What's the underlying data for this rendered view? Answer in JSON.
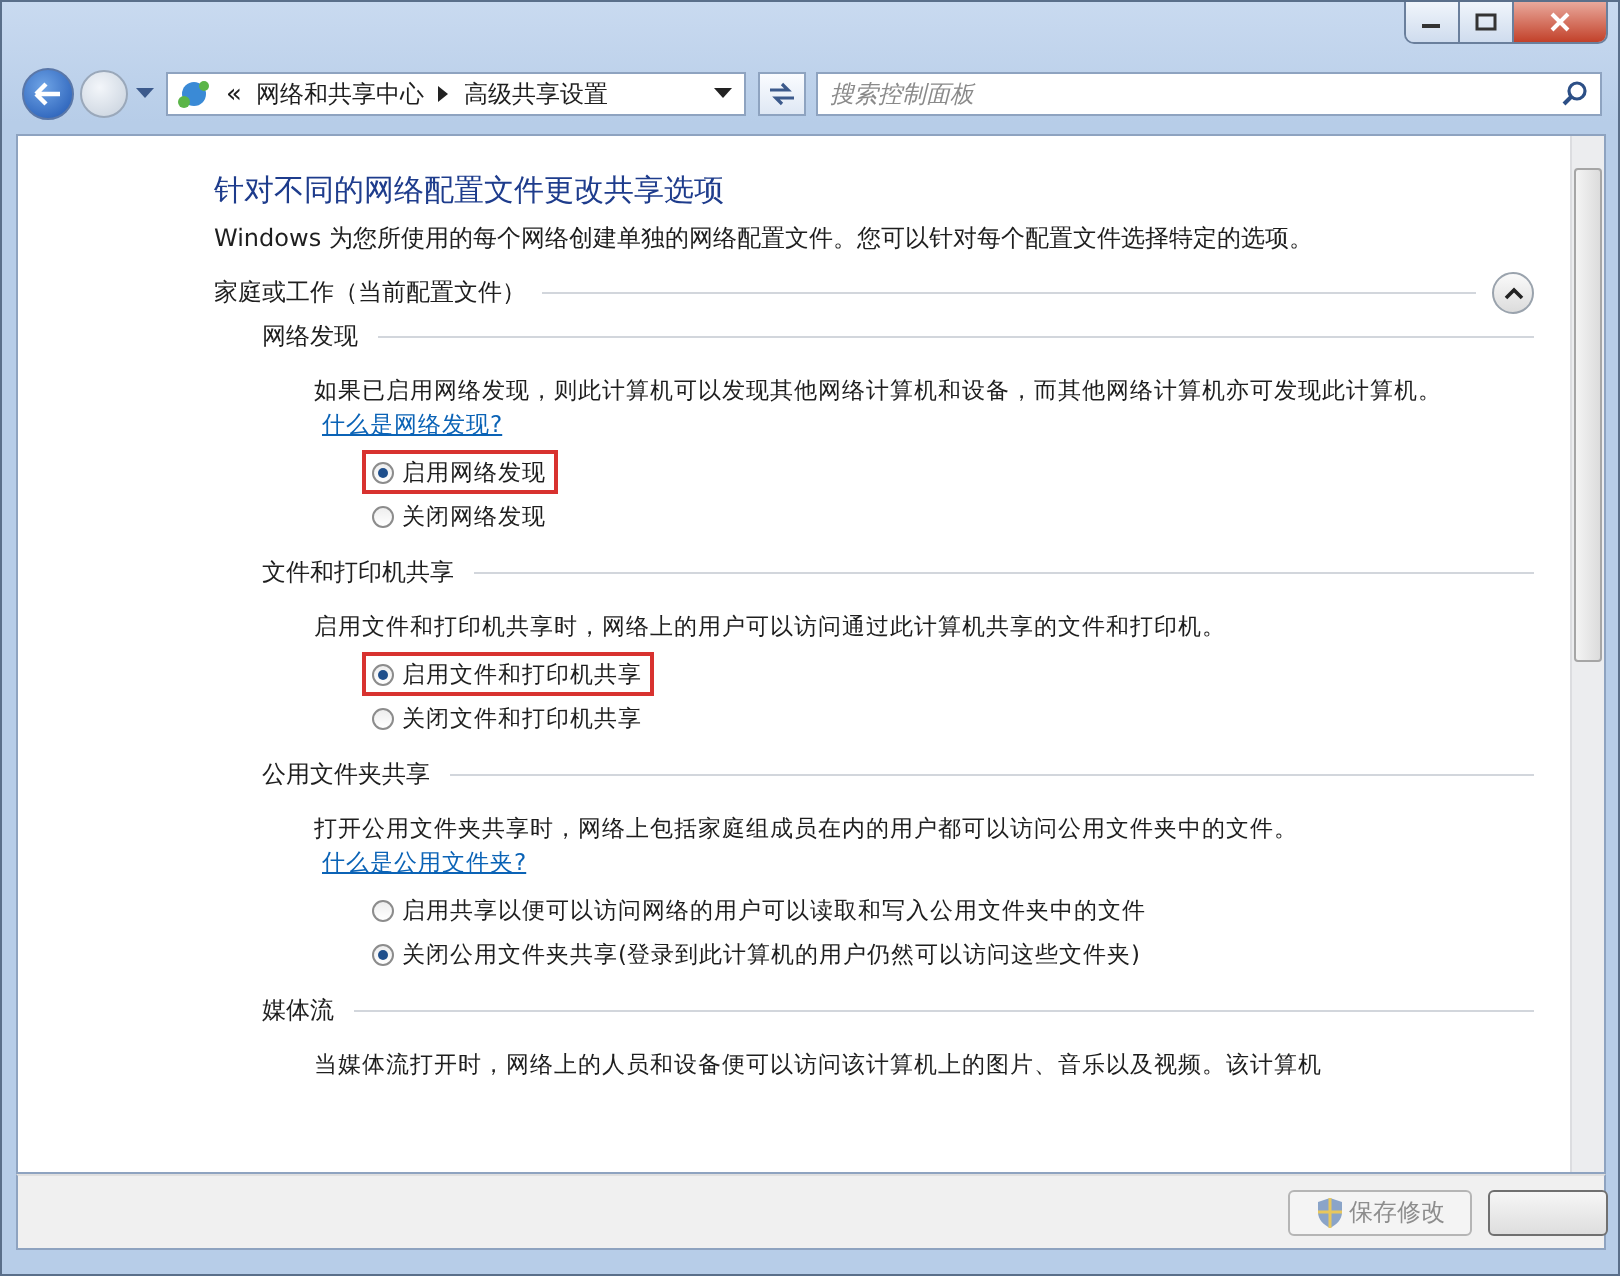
{
  "address_bar": {
    "overflow_chevron": "«",
    "path": [
      "网络和共享中心",
      "高级共享设置"
    ]
  },
  "search": {
    "placeholder": "搜索控制面板"
  },
  "page": {
    "title": "针对不同的网络配置文件更改共享选项",
    "intro": "Windows 为您所使用的每个网络创建单独的网络配置文件。您可以针对每个配置文件选择特定的选项。",
    "profile": {
      "label": "家庭或工作（当前配置文件）",
      "expanded": true
    },
    "sections": [
      {
        "heading": "网络发现",
        "description": "如果已启用网络发现，则此计算机可以发现其他网络计算机和设备，而其他网络计算机亦可发现此计算机。",
        "link": "什么是网络发现?",
        "options": [
          {
            "label": "启用网络发现",
            "selected": true,
            "highlighted": true
          },
          {
            "label": "关闭网络发现",
            "selected": false,
            "highlighted": false
          }
        ]
      },
      {
        "heading": "文件和打印机共享",
        "description": "启用文件和打印机共享时，网络上的用户可以访问通过此计算机共享的文件和打印机。",
        "options": [
          {
            "label": "启用文件和打印机共享",
            "selected": true,
            "highlighted": true
          },
          {
            "label": "关闭文件和打印机共享",
            "selected": false,
            "highlighted": false
          }
        ]
      },
      {
        "heading": "公用文件夹共享",
        "description": "打开公用文件夹共享时，网络上包括家庭组成员在内的用户都可以访问公用文件夹中的文件。",
        "link": "什么是公用文件夹?",
        "options": [
          {
            "label": "启用共享以便可以访问网络的用户可以读取和写入公用文件夹中的文件",
            "selected": false,
            "highlighted": false
          },
          {
            "label": "关闭公用文件夹共享(登录到此计算机的用户仍然可以访问这些文件夹)",
            "selected": true,
            "highlighted": false
          }
        ]
      },
      {
        "heading": "媒体流",
        "description": "当媒体流打开时，网络上的人员和设备便可以访问该计算机上的图片、音乐以及视频。该计算机"
      }
    ]
  },
  "footer": {
    "buttons": [
      {
        "label": "保存修改",
        "disabled": true
      }
    ]
  }
}
